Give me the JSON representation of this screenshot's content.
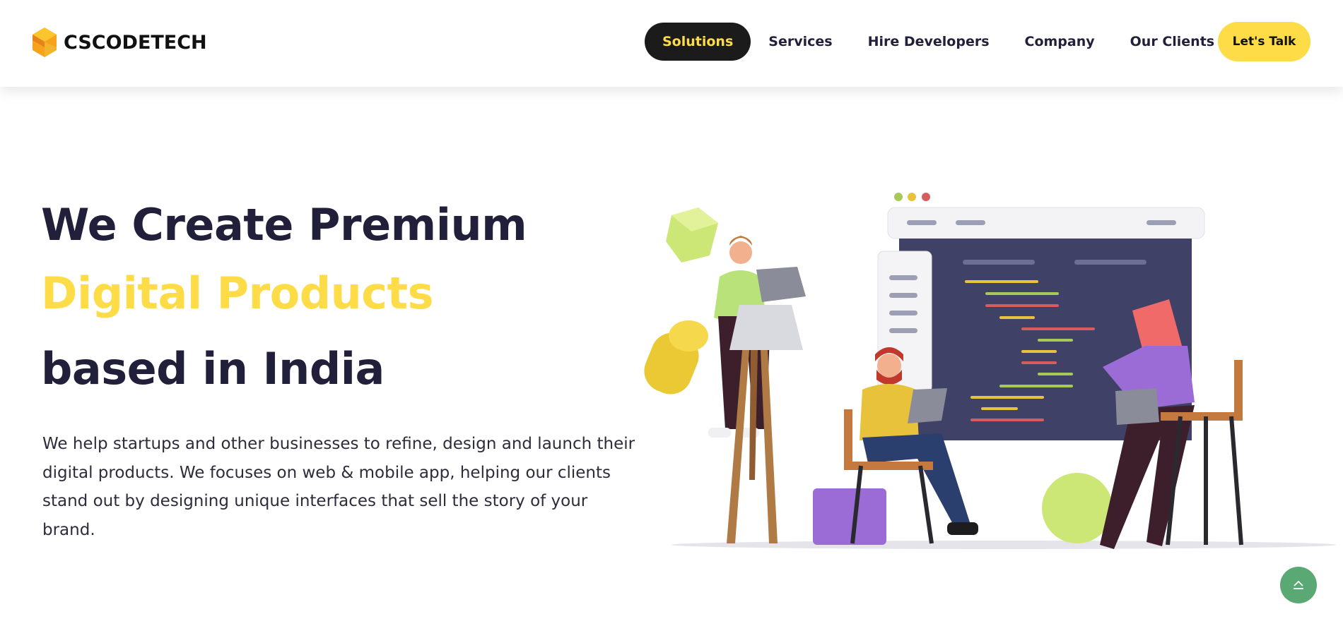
{
  "header": {
    "logo_text": "CSCODETECH",
    "logo_icon": "hexagon-s-logo-icon",
    "nav": [
      {
        "label": "Solutions",
        "active": true
      },
      {
        "label": "Services",
        "active": false
      },
      {
        "label": "Hire Developers",
        "active": false
      },
      {
        "label": "Company",
        "active": false
      },
      {
        "label": "Our Clients",
        "active": false
      }
    ],
    "cta_label": "Let's Talk"
  },
  "hero": {
    "line1": "We Create Premium",
    "line2": "Digital Products",
    "line3": "based in India",
    "description": "We help startups and other businesses to refine, design and launch their digital products. We focuses on web & mobile app, helping our clients stand out by designing unique interfaces that sell the story of your brand.",
    "illustration": "team-working-on-laptops-illustration"
  },
  "scroll_top_icon": "chevron-up-icon",
  "colors": {
    "primary_dark": "#211f3a",
    "accent_yellow": "#fddc47",
    "nav_active_bg": "#1b1b1b",
    "scroll_top_bg": "#5aa874"
  }
}
